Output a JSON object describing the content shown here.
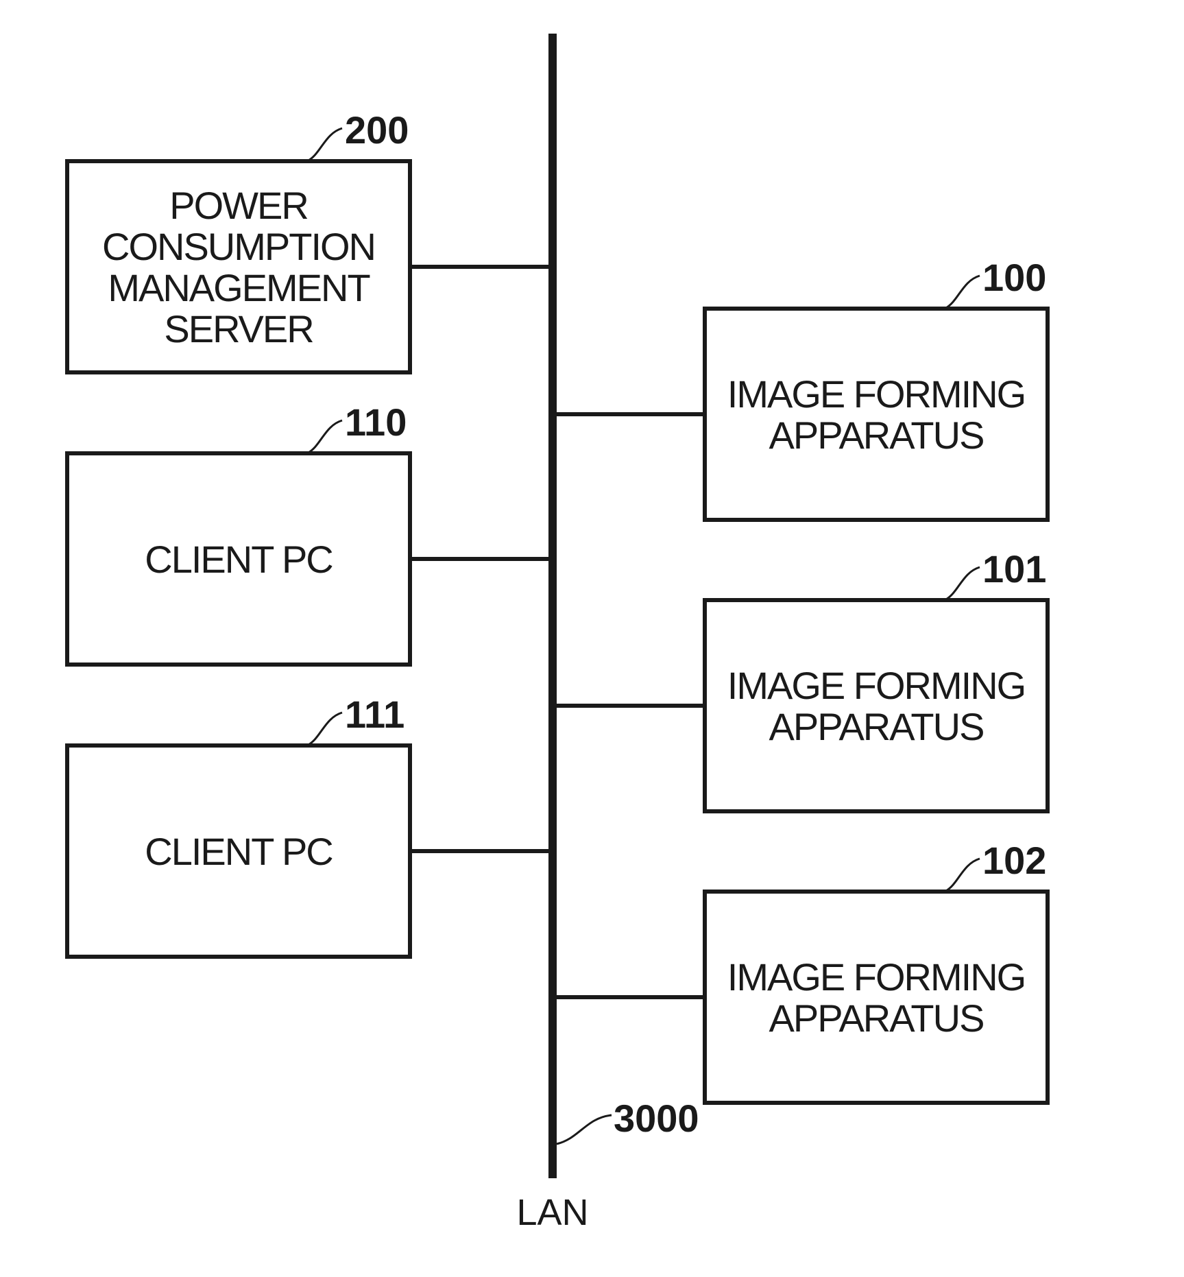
{
  "diagram": {
    "type": "network-block-diagram",
    "lan": {
      "label": "LAN",
      "ref": "3000"
    },
    "left_nodes": [
      {
        "ref": "200",
        "lines": [
          "POWER",
          "CONSUMPTION",
          "MANAGEMENT",
          "SERVER"
        ]
      },
      {
        "ref": "110",
        "lines": [
          "CLIENT PC"
        ]
      },
      {
        "ref": "111",
        "lines": [
          "CLIENT PC"
        ]
      }
    ],
    "right_nodes": [
      {
        "ref": "100",
        "lines": [
          "IMAGE FORMING",
          "APPARATUS"
        ]
      },
      {
        "ref": "101",
        "lines": [
          "IMAGE FORMING",
          "APPARATUS"
        ]
      },
      {
        "ref": "102",
        "lines": [
          "IMAGE FORMING",
          "APPARATUS"
        ]
      }
    ]
  }
}
